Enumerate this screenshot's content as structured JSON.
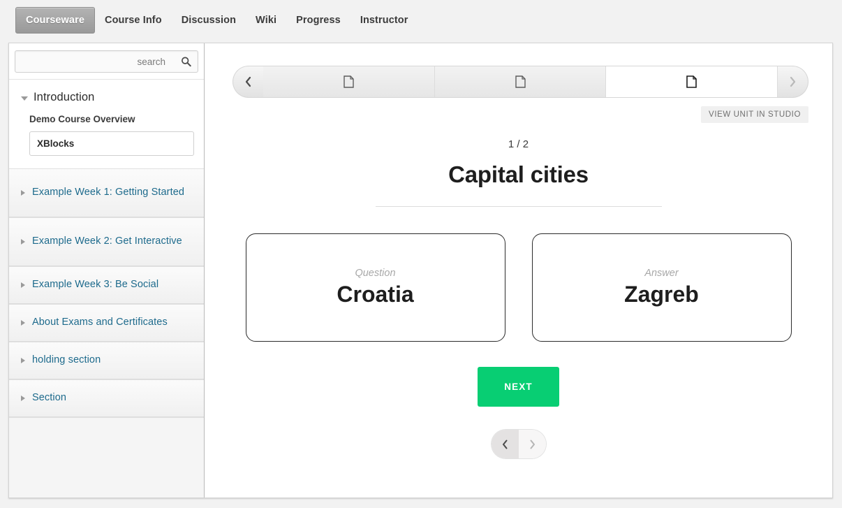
{
  "course_nav": {
    "items": [
      {
        "label": "Courseware",
        "active": true
      },
      {
        "label": "Course Info",
        "active": false
      },
      {
        "label": "Discussion",
        "active": false
      },
      {
        "label": "Wiki",
        "active": false
      },
      {
        "label": "Progress",
        "active": false
      },
      {
        "label": "Instructor",
        "active": false
      }
    ]
  },
  "sidebar": {
    "search": {
      "value": "",
      "placeholder": "search",
      "icon": "search-icon"
    },
    "open_chapter": {
      "title": "Introduction",
      "toggle_icon": "triangle-down-icon",
      "subsection_label": "Demo Course Overview",
      "active_unit": "XBlocks"
    },
    "closed_chapters": [
      {
        "label": "Example Week 1: Getting Started",
        "icon": "triangle-right-icon"
      },
      {
        "label": "Example Week 2: Get Interactive",
        "icon": "triangle-right-icon"
      },
      {
        "label": "Example Week 3: Be Social",
        "icon": "triangle-right-icon"
      },
      {
        "label": "About Exams and Certificates",
        "icon": "triangle-right-icon"
      },
      {
        "label": "holding section",
        "icon": "triangle-right-icon"
      },
      {
        "label": "Section",
        "icon": "triangle-right-icon"
      }
    ]
  },
  "sequence": {
    "prev_icon": "chevron-left-icon",
    "next_icon": "chevron-right-icon",
    "tabs": [
      {
        "icon": "document-icon",
        "active": false
      },
      {
        "icon": "document-icon",
        "active": false
      },
      {
        "icon": "document-icon",
        "active": true
      }
    ]
  },
  "studio": {
    "label": "VIEW UNIT IN STUDIO"
  },
  "unit": {
    "counter": "1 / 2",
    "title": "Capital cities",
    "question_label": "Question",
    "question_value": "Croatia",
    "answer_label": "Answer",
    "answer_value": "Zagreb",
    "next_label": "NEXT"
  },
  "pager": {
    "prev_icon": "chevron-left-icon",
    "next_icon": "chevron-right-icon"
  },
  "colors": {
    "accent_green": "#08ce73",
    "link_blue": "#1d6a8c",
    "page_bg": "#f2f2f2",
    "sidebar_row": "#f3f3f3"
  }
}
